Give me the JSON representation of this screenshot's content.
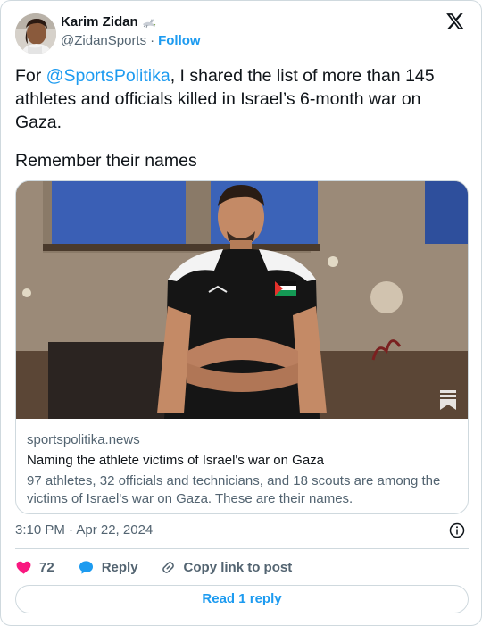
{
  "author": {
    "name": "Karim Zidan",
    "handle": "@ZidanSports",
    "separator": "·",
    "follow_label": "Follow"
  },
  "tweet": {
    "text_prefix": "For ",
    "mention": "@SportsPolitika",
    "text_suffix": ", I shared the list of more than 145 athletes and officials killed in Israel’s 6-month war on Gaza.",
    "text_line2": "Remember their names"
  },
  "link_card": {
    "domain": "sportspolitika.news",
    "title": "Naming the athlete victims of Israel's war on Gaza",
    "description": "97 athletes, 32 officials and technicians, and 18 scouts are among the victims of Israel's war on Gaza. These are their names."
  },
  "timestamp": "3:10 PM · Apr 22, 2024",
  "actions": {
    "likes_count": "72",
    "reply_label": "Reply",
    "copy_link_label": "Copy link to post"
  },
  "read_reply_label": "Read 1 reply",
  "colors": {
    "accent": "#1d9bf0",
    "like": "#f91880",
    "secondary_text": "#536471",
    "border": "#cfd9de"
  },
  "icons": [
    "dove-emoji-icon",
    "x-logo-icon",
    "bookmark-icon",
    "info-icon",
    "heart-icon",
    "reply-bubble-icon",
    "link-icon"
  ]
}
